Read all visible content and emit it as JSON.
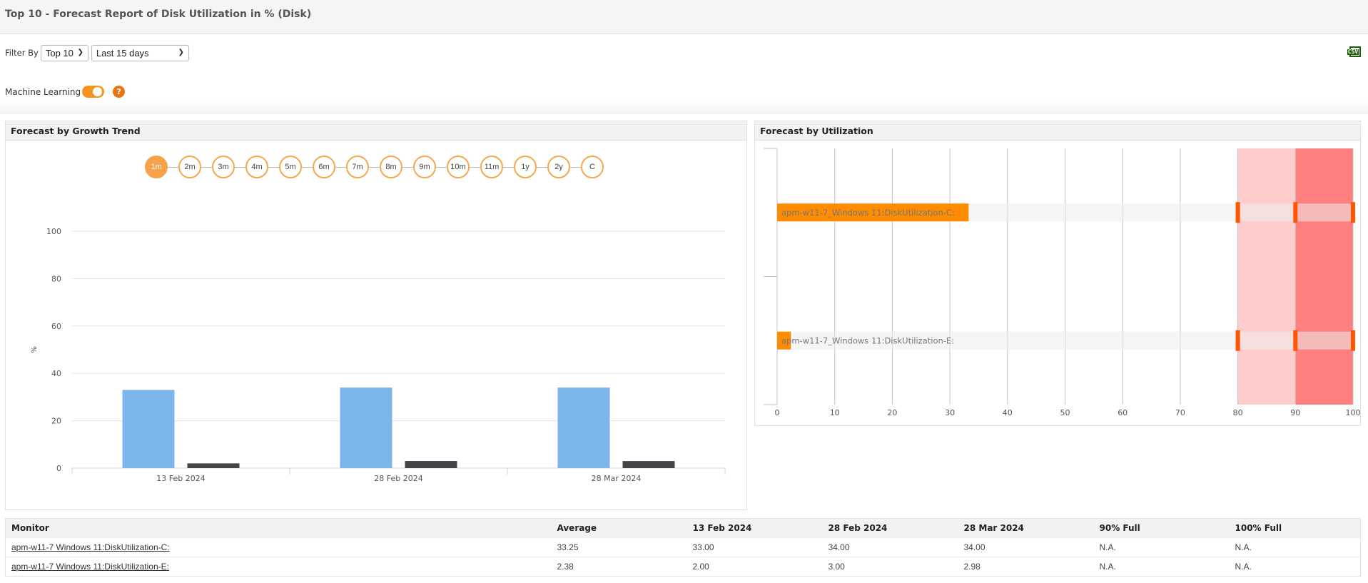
{
  "page": {
    "title": "Top 10 - Forecast Report of Disk Utilization in % (Disk)"
  },
  "filters": {
    "label": "Filter By",
    "top_selected": "Top 10",
    "period_selected": "Last 15 days"
  },
  "export": {
    "icon": "csv-export-icon",
    "label": "CSV"
  },
  "machine_learning": {
    "label": "Machine Learning",
    "enabled": true,
    "help_glyph": "?"
  },
  "colors": {
    "accent": "#f7941d",
    "bar_actual": "#7cb5ec",
    "bar_forecast": "#434348",
    "util_bar": "#ff8c00",
    "zone_warning": "#ffcccc",
    "zone_critical": "#ff7f7f",
    "marker": "#ff5500"
  },
  "growth_panel": {
    "title": "Forecast by Growth Trend",
    "periods": [
      "1m",
      "2m",
      "3m",
      "4m",
      "5m",
      "6m",
      "7m",
      "8m",
      "9m",
      "10m",
      "11m",
      "1y",
      "2y",
      "C"
    ],
    "active_period": "1m"
  },
  "utilization_panel": {
    "title": "Forecast by Utilization"
  },
  "chart_data": [
    {
      "type": "bar",
      "title": "Forecast by Growth Trend",
      "xlabel": "",
      "ylabel": "%",
      "ylim": [
        0,
        100
      ],
      "yticks": [
        "0",
        "20",
        "40",
        "60",
        "80",
        "100"
      ],
      "grid": true,
      "categories": [
        "13 Feb 2024",
        "28 Feb 2024",
        "28 Mar 2024"
      ],
      "series": [
        {
          "name": "apm-w11-7_Windows 11:DiskUtilization-C:",
          "values": [
            33,
            34,
            34
          ]
        },
        {
          "name": "apm-w11-7_Windows 11:DiskUtilization-E:",
          "values": [
            2,
            3,
            2.98
          ]
        }
      ]
    },
    {
      "type": "bar",
      "orientation": "horizontal",
      "title": "Forecast by Utilization",
      "xlim": [
        0,
        100
      ],
      "xticks": [
        "0",
        "10",
        "20",
        "30",
        "40",
        "50",
        "60",
        "70",
        "80",
        "90",
        "100"
      ],
      "grid": true,
      "plot_bands": [
        {
          "from": 80,
          "to": 90,
          "level": "warning"
        },
        {
          "from": 90,
          "to": 100,
          "level": "critical"
        }
      ],
      "threshold_markers": [
        80,
        90,
        100
      ],
      "categories": [
        "apm-w11-7_Windows 11:DiskUtilization-C:",
        "apm-w11-7_Windows 11:DiskUtilization-E:"
      ],
      "values": [
        33.25,
        2.38
      ]
    }
  ],
  "table": {
    "headers": [
      "Monitor",
      "Average",
      "13 Feb 2024",
      "28 Feb 2024",
      "28 Mar 2024",
      "90% Full",
      "100% Full"
    ],
    "rows": [
      [
        "apm-w11-7 Windows 11:DiskUtilization-C:",
        "33.25",
        "33.00",
        "34.00",
        "34.00",
        "N.A.",
        "N.A."
      ],
      [
        "apm-w11-7 Windows 11:DiskUtilization-E:",
        "2.38",
        "2.00",
        "3.00",
        "2.98",
        "N.A.",
        "N.A."
      ]
    ]
  }
}
